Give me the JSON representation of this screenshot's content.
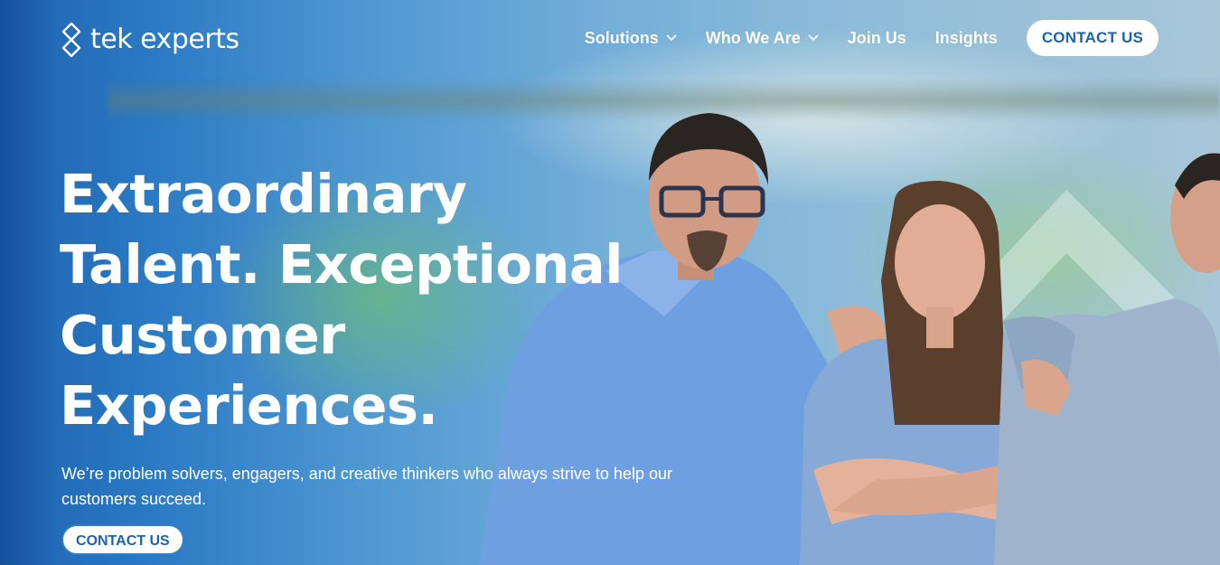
{
  "brand": {
    "name": "tek experts",
    "logo_icon": "tek-experts-logo-icon"
  },
  "nav": {
    "items": [
      {
        "label": "Solutions",
        "has_dropdown": true
      },
      {
        "label": "Who We Are",
        "has_dropdown": true
      },
      {
        "label": "Join Us",
        "has_dropdown": false
      },
      {
        "label": "Insights",
        "has_dropdown": false
      }
    ],
    "contact_label": "CONTACT US"
  },
  "hero": {
    "headline_lines": [
      "Extraordinary",
      "Talent. Exceptional",
      "Customer",
      "Experiences."
    ],
    "subtext": "We’re problem solvers, engagers, and creative thinkers who always strive to help our customers succeed.",
    "cta_label": "CONTACT US"
  },
  "colors": {
    "accent": "#1d63a8",
    "hero_blue": "#2a79c3",
    "text_light": "#ffffff"
  }
}
